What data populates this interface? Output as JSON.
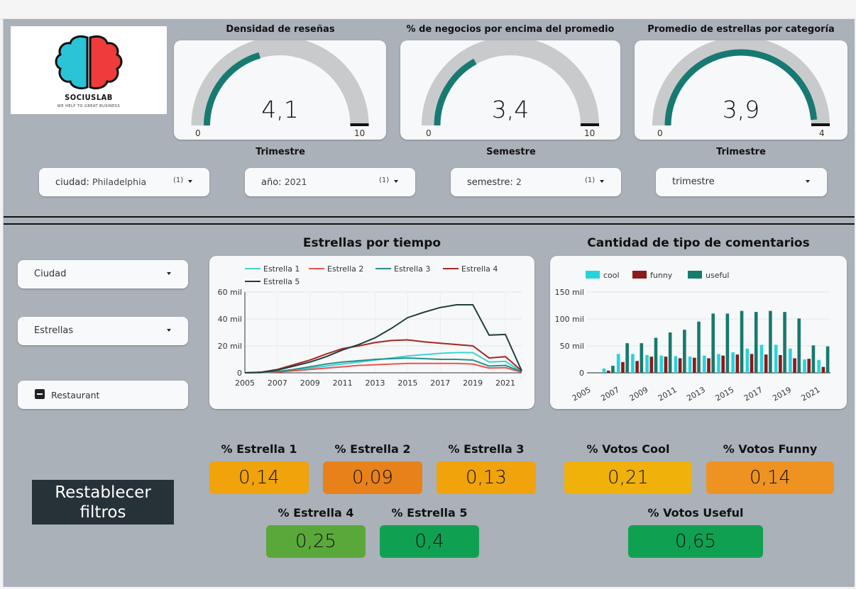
{
  "logo": {
    "name": "SOCIUSLAB",
    "tagline": "WE HELP TO GREAT BUSINESS",
    "colors": {
      "left": "#2bc3d6",
      "right": "#ef3b3b"
    }
  },
  "gauges": [
    {
      "title": "Densidad de reseñas",
      "value_text": "4,1",
      "value": 4.1,
      "min": "0",
      "max": "10",
      "max_num": 10,
      "fill_color": "#177a72"
    },
    {
      "title": "% de negocios por encima del promedio",
      "value_text": "3,4",
      "value": 3.4,
      "min": "0",
      "max": "10",
      "max_num": 10,
      "fill_color": "#177a72"
    },
    {
      "title": "Promedio de estrellas por categoría",
      "value_text": "3,9",
      "value": 3.9,
      "min": "0",
      "max": "4",
      "max_num": 4,
      "fill_color": "#177a72"
    }
  ],
  "filter_titles": {
    "trimestre_1": "Trimestre",
    "semestre": "Semestre",
    "trimestre_2": "Trimestre"
  },
  "filters": [
    {
      "label": "ciudad:",
      "value": "Philadelphia",
      "count": "(1)"
    },
    {
      "label": "año:",
      "value": "2021",
      "count": "(1)"
    },
    {
      "label": "semestre:",
      "value": "2",
      "count": "(1)"
    },
    {
      "label": "trimestre",
      "value": "",
      "count": ""
    }
  ],
  "side_filters": {
    "ciudad": "Ciudad",
    "estrellas": "Estrellas",
    "category": "Restaurant"
  },
  "reset_button": "Restablecer filtros",
  "chart_titles": {
    "stars": "Estrellas por tiempo",
    "comments": "Cantidad de tipo de comentarios"
  },
  "chart_data": [
    {
      "type": "line",
      "title": "Estrellas por tiempo",
      "x": [
        2005,
        2006,
        2007,
        2008,
        2009,
        2010,
        2011,
        2012,
        2013,
        2014,
        2015,
        2016,
        2017,
        2018,
        2019,
        2020,
        2021,
        2022
      ],
      "x_ticks": [
        "2005",
        "2007",
        "2009",
        "2011",
        "2013",
        "2015",
        "2017",
        "2019",
        "2021"
      ],
      "y_ticks": [
        "0",
        "20 mil",
        "40 mil",
        "60 mil"
      ],
      "ylim": [
        0,
        60000
      ],
      "series": [
        {
          "name": "Estrella 1",
          "color": "#3ad4d4",
          "values": [
            0,
            200,
            800,
            2000,
            3500,
            5000,
            6500,
            8000,
            9500,
            11000,
            12500,
            13500,
            14500,
            15000,
            15000,
            8000,
            8500,
            1000
          ]
        },
        {
          "name": "Estrella 2",
          "color": "#ef5350",
          "values": [
            0,
            150,
            600,
            1500,
            2500,
            3500,
            4500,
            5500,
            6000,
            6500,
            7000,
            7000,
            7000,
            7000,
            6500,
            3500,
            3800,
            500
          ]
        },
        {
          "name": "Estrella 3",
          "color": "#26908a",
          "values": [
            0,
            250,
            1000,
            2500,
            4500,
            6500,
            8000,
            9000,
            10000,
            10500,
            11000,
            10500,
            10000,
            10000,
            9500,
            5000,
            5500,
            800
          ]
        },
        {
          "name": "Estrella 4",
          "color": "#a3281f",
          "values": [
            0,
            500,
            2500,
            6000,
            9500,
            14000,
            18000,
            20000,
            22500,
            24000,
            24500,
            23000,
            22000,
            21000,
            20000,
            11000,
            12000,
            1500
          ]
        },
        {
          "name": "Estrella 5",
          "color": "#1e3f3f",
          "values": [
            0,
            400,
            2000,
            5000,
            8000,
            12000,
            17000,
            21000,
            26000,
            33000,
            41000,
            45000,
            48500,
            50500,
            50500,
            28000,
            28500,
            1500
          ]
        }
      ]
    },
    {
      "type": "bar",
      "title": "Cantidad de tipo de comentarios",
      "categories": [
        "2005",
        "2006",
        "2007",
        "2008",
        "2009",
        "2010",
        "2011",
        "2012",
        "2013",
        "2014",
        "2015",
        "2016",
        "2017",
        "2018",
        "2019",
        "2020",
        "2021"
      ],
      "x_ticks": [
        "2005",
        "2007",
        "2009",
        "2011",
        "2013",
        "2015",
        "2017",
        "2019",
        "2021"
      ],
      "y_ticks": [
        "0",
        "50 mil",
        "100 mil",
        "150 mil"
      ],
      "ylim": [
        0,
        150000
      ],
      "series": [
        {
          "name": "cool",
          "color": "#26d4dc",
          "values": [
            0,
            8000,
            35000,
            35000,
            33000,
            32000,
            31000,
            30000,
            32000,
            35000,
            38000,
            45000,
            52000,
            52000,
            45000,
            25000,
            24000
          ]
        },
        {
          "name": "funny",
          "color": "#8b1a1a",
          "values": [
            0,
            4000,
            20000,
            22000,
            30000,
            30000,
            27000,
            28000,
            27000,
            32000,
            34000,
            35000,
            34000,
            33000,
            27000,
            26000,
            11000
          ]
        },
        {
          "name": "useful",
          "color": "#167a6e",
          "values": [
            0,
            13000,
            55000,
            55000,
            65000,
            75000,
            80000,
            95000,
            110000,
            110000,
            115000,
            113000,
            115000,
            113000,
            101000,
            51000,
            49000
          ]
        }
      ]
    }
  ],
  "kpis": [
    {
      "title": "% Estrella 1",
      "value": "0,14",
      "color": "#f0a30a"
    },
    {
      "title": "% Estrella 2",
      "value": "0,09",
      "color": "#e8811a"
    },
    {
      "title": "% Estrella 3",
      "value": "0,13",
      "color": "#f0a30a"
    },
    {
      "title": "% Votos Cool",
      "value": "0,21",
      "color": "#f0b10a"
    },
    {
      "title": "% Votos Funny",
      "value": "0,14",
      "color": "#ee9322"
    },
    {
      "title": "% Estrella 4",
      "value": "0,25",
      "color": "#5aa83a"
    },
    {
      "title": "% Estrella 5",
      "value": "0,4",
      "color": "#10a052"
    },
    {
      "title": "% Votos Useful",
      "value": "0,65",
      "color": "#10a052"
    }
  ]
}
